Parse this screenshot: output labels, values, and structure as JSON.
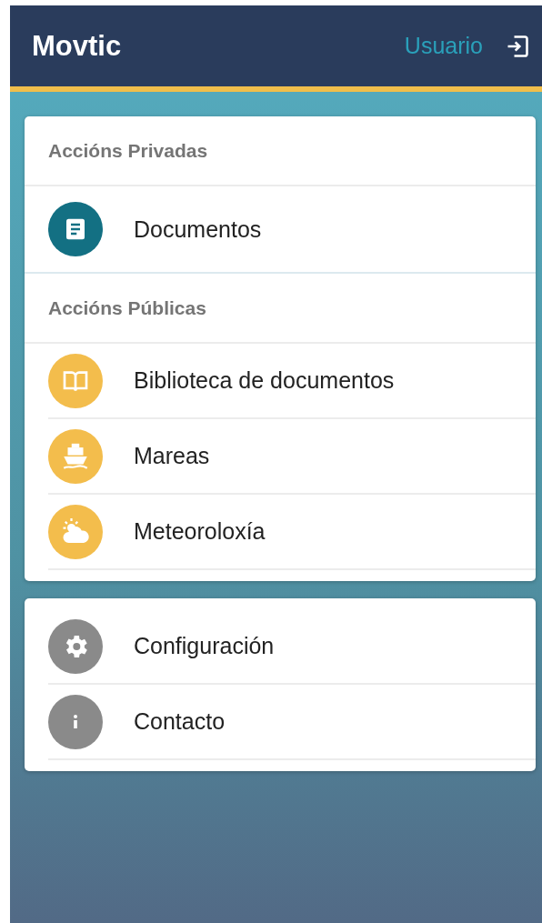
{
  "header": {
    "title": "Movtic",
    "user_link": "Usuario"
  },
  "cards": [
    {
      "sections": [
        {
          "title": "Accións Privadas",
          "items": [
            {
              "label": "Documentos",
              "color": "#137083"
            }
          ]
        },
        {
          "title": "Accións Públicas",
          "items": [
            {
              "label": "Biblioteca de documentos",
              "color": "#f3bd4c"
            },
            {
              "label": "Mareas",
              "color": "#f3bd4c"
            },
            {
              "label": "Meteoroloxía",
              "color": "#f3bd4c"
            }
          ]
        }
      ]
    },
    {
      "sections": [
        {
          "items": [
            {
              "label": "Configuración",
              "color": "#8a8a8a"
            },
            {
              "label": "Contacto",
              "color": "#8a8a8a"
            }
          ]
        }
      ]
    }
  ]
}
